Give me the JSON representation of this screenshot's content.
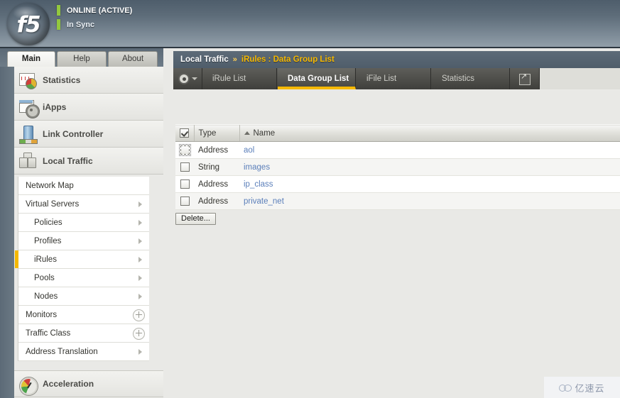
{
  "header": {
    "logo_text": "f5",
    "logo_icon": "f5-logo-icon",
    "status_primary": "ONLINE (ACTIVE)",
    "status_secondary": "In Sync",
    "status_color": "#93c83e",
    "gradient_top": "#4e5d6b",
    "gradient_bottom": "#929fa9"
  },
  "nav_tabs": [
    {
      "label": "Main",
      "active": true
    },
    {
      "label": "Help",
      "active": false
    },
    {
      "label": "About",
      "active": false
    }
  ],
  "modules": [
    {
      "label": "Statistics",
      "icon": "statistics-icon"
    },
    {
      "label": "iApps",
      "icon": "iapps-icon"
    },
    {
      "label": "Link Controller",
      "icon": "link-controller-icon"
    },
    {
      "label": "Local Traffic",
      "icon": "local-traffic-icon"
    }
  ],
  "footer_module": {
    "label": "Acceleration",
    "icon": "acceleration-icon"
  },
  "submenu": [
    {
      "label": "Network Map",
      "level": 1,
      "affordance": "none",
      "active": false
    },
    {
      "label": "Virtual Servers",
      "level": 1,
      "affordance": "chevron",
      "active": false
    },
    {
      "label": "Policies",
      "level": 2,
      "affordance": "chevron",
      "active": false
    },
    {
      "label": "Profiles",
      "level": 2,
      "affordance": "chevron",
      "active": false
    },
    {
      "label": "iRules",
      "level": 2,
      "affordance": "chevron",
      "active": true
    },
    {
      "label": "Pools",
      "level": 2,
      "affordance": "chevron",
      "active": false
    },
    {
      "label": "Nodes",
      "level": 2,
      "affordance": "chevron",
      "active": false
    },
    {
      "label": "Monitors",
      "level": 1,
      "affordance": "plus",
      "active": false
    },
    {
      "label": "Traffic Class",
      "level": 1,
      "affordance": "plus",
      "active": false
    },
    {
      "label": "Address Translation",
      "level": 1,
      "affordance": "chevron",
      "active": false
    }
  ],
  "breadcrumb": {
    "root": "Local Traffic",
    "separator": "»",
    "leaf": "iRules : Data Group List",
    "leaf_color": "#f5b800"
  },
  "subtabs": [
    {
      "label": "iRule List",
      "active": false
    },
    {
      "label": "Data Group List",
      "active": true
    },
    {
      "label": "iFile List",
      "active": false
    },
    {
      "label": "Statistics",
      "active": false
    }
  ],
  "toolbar": {
    "gear_icon": "gear-icon",
    "gear_dropdown_icon": "chevron-down-icon",
    "popout_icon": "popout-icon"
  },
  "table": {
    "select_all_checked": true,
    "sort_column": "Name",
    "sort_direction": "ascending",
    "columns": [
      "",
      "Type",
      "Name"
    ],
    "rows": [
      {
        "checked": false,
        "focused": true,
        "type": "Address",
        "name": "aol"
      },
      {
        "checked": false,
        "focused": false,
        "type": "String",
        "name": "images"
      },
      {
        "checked": false,
        "focused": false,
        "type": "Address",
        "name": "ip_class"
      },
      {
        "checked": false,
        "focused": false,
        "type": "Address",
        "name": "private_net"
      }
    ],
    "link_color": "#5b7fba"
  },
  "actions": {
    "delete_label": "Delete..."
  },
  "watermark": {
    "text": "亿速云",
    "icon": "cloud-icon"
  }
}
